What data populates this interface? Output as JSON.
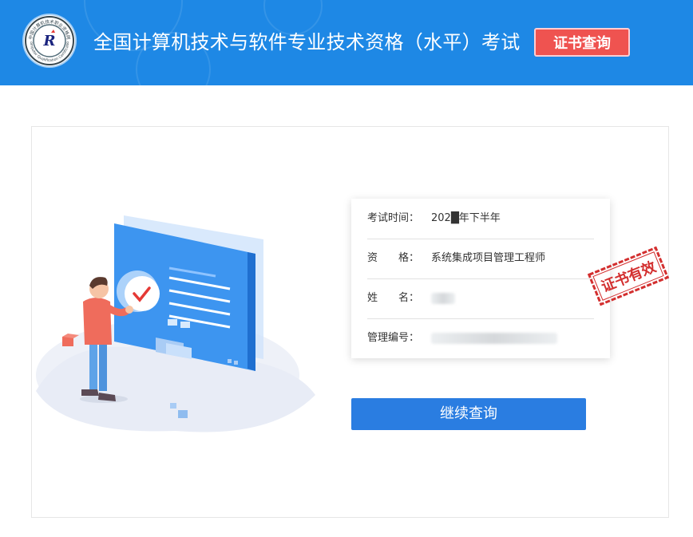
{
  "header": {
    "title": "全国计算机技术与软件专业技术资格（水平）考试",
    "query_button": "证书查询",
    "logo_text_top": "中国计算机技术职业资格网",
    "logo_text_bottom": "Computer Qualification Certification",
    "logo_emblem": "R"
  },
  "info": {
    "rows": [
      {
        "label": "考试时间：",
        "value": "202█年下半年"
      },
      {
        "label": "资　　格：",
        "value": "系统集成项目管理工程师"
      },
      {
        "label": "姓　　名：",
        "value": ""
      },
      {
        "label": "管理编号：",
        "value": ""
      }
    ]
  },
  "stamp": {
    "text": "证书有效"
  },
  "actions": {
    "continue_label": "继续查询"
  },
  "colors": {
    "header_bg": "#1e88e5",
    "query_button_bg": "#ef5350",
    "continue_button_bg": "#2a7de1",
    "stamp_red": "#d32f2f"
  }
}
